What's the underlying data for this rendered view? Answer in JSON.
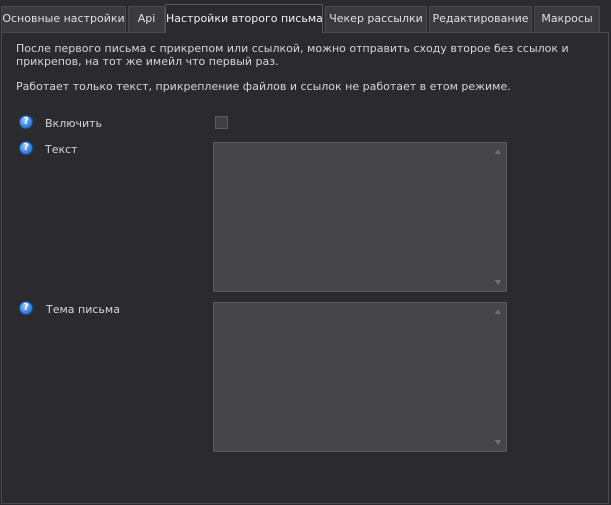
{
  "tabs": [
    {
      "label": "Основные настройки",
      "active": false
    },
    {
      "label": "Api",
      "active": false
    },
    {
      "label": "Настройки второго письма",
      "active": true
    },
    {
      "label": "Чекер рассылки",
      "active": false
    },
    {
      "label": "Редактирование",
      "active": false
    },
    {
      "label": "Макросы",
      "active": false
    }
  ],
  "description": {
    "line1": "После первого письма с прикрепом или ссылкой, можно отправить сходу второе без ссылок и",
    "line2": "прикрепов, на тот же имейл что первый раз.",
    "line3": "Работает только текст, прикрепление файлов и ссылок не работает в етом режиме."
  },
  "fields": {
    "enable": {
      "label": "Включить",
      "checked": false
    },
    "text": {
      "label": "Текст",
      "value": ""
    },
    "subject": {
      "label": "Тема письма",
      "value": ""
    }
  },
  "icons": {
    "help": "help-question-icon"
  },
  "colors": {
    "background": "#2b2b2f",
    "tab_inactive": "#3a3a3f",
    "input_bg": "#464649",
    "help_icon": "#3d86e0"
  }
}
